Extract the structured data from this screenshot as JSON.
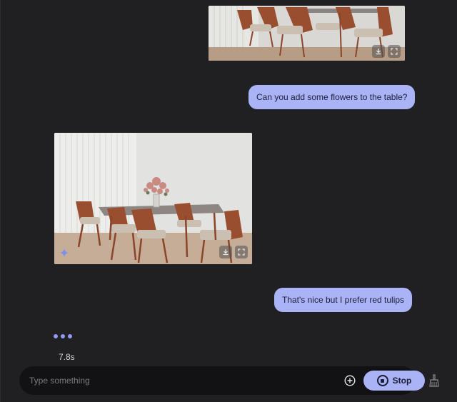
{
  "messages": [
    {
      "role": "assistant",
      "type": "image",
      "image": "dining table with wooden chairs, cropped top"
    },
    {
      "role": "user",
      "text": "Can you add some flowers to the table?"
    },
    {
      "role": "assistant",
      "type": "image",
      "image": "dining table with flower vase and wooden chairs"
    },
    {
      "role": "user",
      "text": "That's nice but I prefer red tulips"
    }
  ],
  "status": {
    "elapsed": "7.8s"
  },
  "composer": {
    "placeholder": "Type something",
    "value": "",
    "stop_label": "Stop"
  },
  "icons": {
    "download": "download-icon",
    "fullscreen": "fullscreen-icon",
    "sparkle": "sparkle-icon",
    "add": "plus-circle-icon",
    "stop": "stop-circle-icon",
    "clear": "broom-icon"
  },
  "colors": {
    "background": "#202022",
    "user_bubble": "#a9b3f5",
    "accent": "#8f9bf0",
    "composer": "#121214"
  }
}
